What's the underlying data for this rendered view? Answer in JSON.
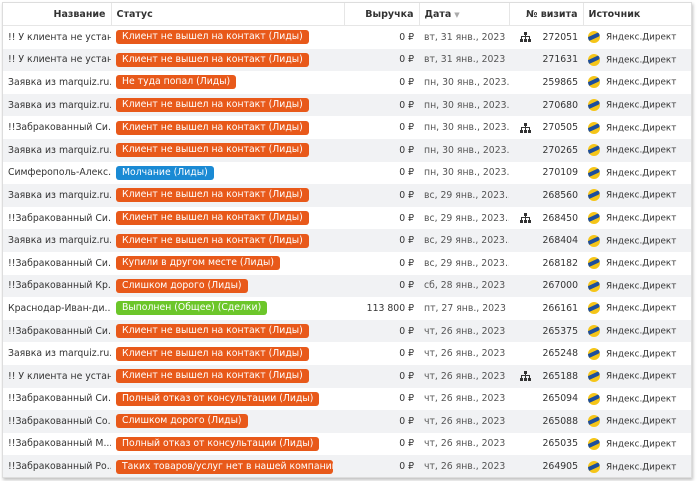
{
  "columns": {
    "name": "Название",
    "status": "Статус",
    "revenue": "Выручка",
    "date": "Дата",
    "visit": "№ визита",
    "source": "Источник"
  },
  "sort_icon": "sort-down-icon",
  "colors": {
    "orange": "#e8591a",
    "blue": "#1a8ad4",
    "green": "#6cc62a",
    "alt_row": "#f1f2f4"
  },
  "rows": [
    {
      "name": "!! У клиента не устан...",
      "status": "Клиент не вышел на контакт (Лиды)",
      "color": "orange",
      "revenue": "0 ₽",
      "date": "вт, 31 янв., 2023 ...",
      "tree": true,
      "visit": "272051",
      "source": "Яндекс.Директ"
    },
    {
      "name": "!! У клиента не устан...",
      "status": "Клиент не вышел на контакт (Лиды)",
      "color": "orange",
      "revenue": "0 ₽",
      "date": "вт, 31 янв., 2023 ...",
      "tree": false,
      "visit": "271631",
      "source": "Яндекс.Директ"
    },
    {
      "name": "Заявка из marquiz.ru...",
      "status": "Не туда попал (Лиды)",
      "color": "orange",
      "revenue": "0 ₽",
      "date": "пн, 30 янв., 2023...",
      "tree": false,
      "visit": "259865",
      "source": "Яндекс.Директ"
    },
    {
      "name": "Заявка из marquiz.ru...",
      "status": "Клиент не вышел на контакт (Лиды)",
      "color": "orange",
      "revenue": "0 ₽",
      "date": "пн, 30 янв., 2023...",
      "tree": false,
      "visit": "270680",
      "source": "Яндекс.Директ"
    },
    {
      "name": "!!Забракованный Си...",
      "status": "Клиент не вышел на контакт (Лиды)",
      "color": "orange",
      "revenue": "0 ₽",
      "date": "пн, 30 янв., 2023...",
      "tree": true,
      "visit": "270505",
      "source": "Яндекс.Директ"
    },
    {
      "name": "Заявка из marquiz.ru...",
      "status": "Клиент не вышел на контакт (Лиды)",
      "color": "orange",
      "revenue": "0 ₽",
      "date": "пн, 30 янв., 2023...",
      "tree": false,
      "visit": "270265",
      "source": "Яндекс.Директ"
    },
    {
      "name": "Симферополь-Алекс...",
      "status": "Молчание (Лиды)",
      "color": "blue",
      "revenue": "0 ₽",
      "date": "пн, 30 янв., 2023...",
      "tree": false,
      "visit": "270109",
      "source": "Яндекс.Директ"
    },
    {
      "name": "Заявка из marquiz.ru...",
      "status": "Клиент не вышел на контакт (Лиды)",
      "color": "orange",
      "revenue": "0 ₽",
      "date": "вс, 29 янв., 2023...",
      "tree": false,
      "visit": "268560",
      "source": "Яндекс.Директ"
    },
    {
      "name": "!!Забракованный Си...",
      "status": "Клиент не вышел на контакт (Лиды)",
      "color": "orange",
      "revenue": "0 ₽",
      "date": "вс, 29 янв., 2023...",
      "tree": true,
      "visit": "268450",
      "source": "Яндекс.Директ"
    },
    {
      "name": "Заявка из marquiz.ru...",
      "status": "Клиент не вышел на контакт (Лиды)",
      "color": "orange",
      "revenue": "0 ₽",
      "date": "вс, 29 янв., 2023...",
      "tree": false,
      "visit": "268404",
      "source": "Яндекс.Директ"
    },
    {
      "name": "!!Забракованный Си...",
      "status": "Купили в другом месте (Лиды)",
      "color": "orange",
      "revenue": "0 ₽",
      "date": "вс, 29 янв., 2023...",
      "tree": false,
      "visit": "268182",
      "source": "Яндекс.Директ"
    },
    {
      "name": "!!Забракованный Кр...",
      "status": "Слишком дорого (Лиды)",
      "color": "orange",
      "revenue": "0 ₽",
      "date": "сб, 28 янв., 2023 ...",
      "tree": false,
      "visit": "267000",
      "source": "Яндекс.Директ"
    },
    {
      "name": "Краснодар-Иван-ди...",
      "status": "Выполнен (Общее) (Сделки)",
      "color": "green",
      "revenue": "113 800 ₽",
      "date": "пт, 27 янв., 2023 ...",
      "tree": false,
      "visit": "266161",
      "source": "Яндекс.Директ"
    },
    {
      "name": "!!Забракованный Си...",
      "status": "Клиент не вышел на контакт (Лиды)",
      "color": "orange",
      "revenue": "0 ₽",
      "date": "чт, 26 янв., 2023 ...",
      "tree": false,
      "visit": "265375",
      "source": "Яндекс.Директ"
    },
    {
      "name": "Заявка из marquiz.ru...",
      "status": "Клиент не вышел на контакт (Лиды)",
      "color": "orange",
      "revenue": "0 ₽",
      "date": "чт, 26 янв., 2023 ...",
      "tree": false,
      "visit": "265248",
      "source": "Яндекс.Директ"
    },
    {
      "name": "!! У клиента не устан...",
      "status": "Клиент не вышел на контакт (Лиды)",
      "color": "orange",
      "revenue": "0 ₽",
      "date": "чт, 26 янв., 2023 ...",
      "tree": true,
      "visit": "265188",
      "source": "Яндекс.Директ"
    },
    {
      "name": "!!Забракованный Си...",
      "status": "Полный отказ от консультации (Лиды)",
      "color": "orange",
      "revenue": "0 ₽",
      "date": "чт, 26 янв., 2023 ...",
      "tree": false,
      "visit": "265094",
      "source": "Яндекс.Директ"
    },
    {
      "name": "!!Забракованный Со...",
      "status": "Слишком дорого (Лиды)",
      "color": "orange",
      "revenue": "0 ₽",
      "date": "чт, 26 янв., 2023 ...",
      "tree": false,
      "visit": "265088",
      "source": "Яндекс.Директ"
    },
    {
      "name": "!!Забракованный М...",
      "status": "Полный отказ от консультации (Лиды)",
      "color": "orange",
      "revenue": "0 ₽",
      "date": "чт, 26 янв., 2023 ...",
      "tree": false,
      "visit": "265035",
      "source": "Яндекс.Директ"
    },
    {
      "name": "!!Забракованный Ро...",
      "status": "Таких товаров/услуг нет в нашей компании (Лид",
      "color": "orange",
      "revenue": "0 ₽",
      "date": "чт, 26 янв., 2023 ...",
      "tree": false,
      "visit": "264905",
      "source": "Яндекс.Директ"
    }
  ]
}
